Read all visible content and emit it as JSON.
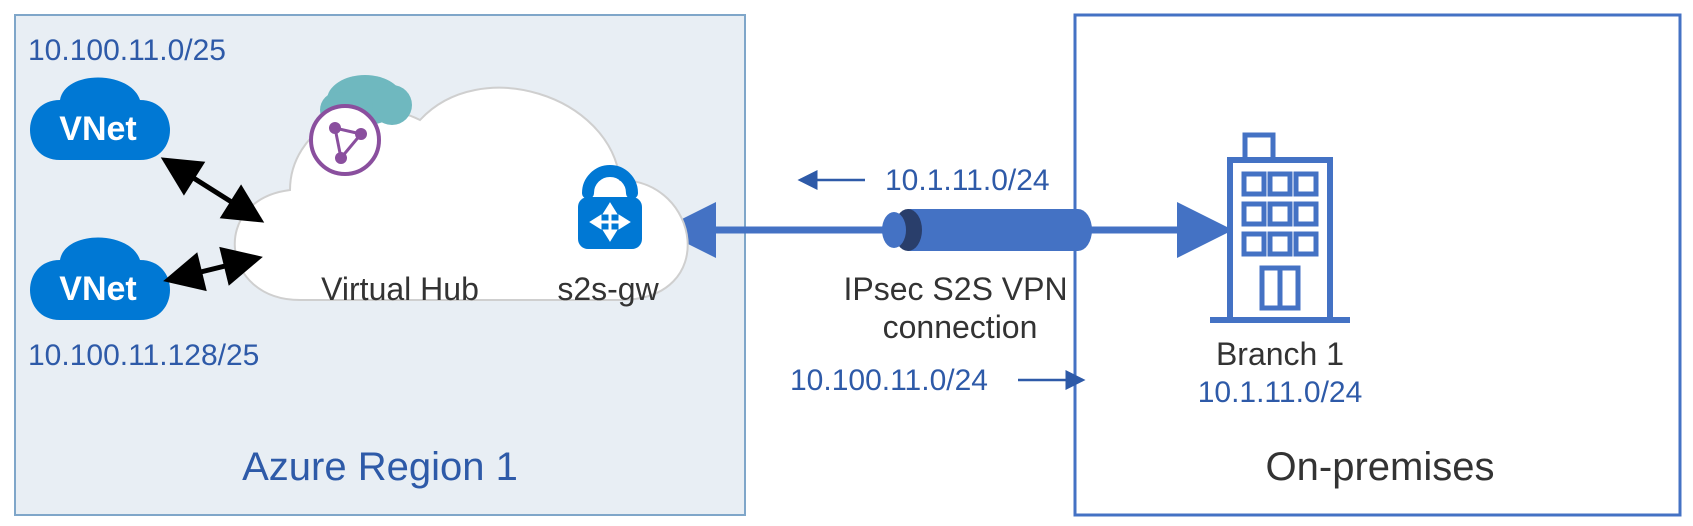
{
  "azure": {
    "region_label": "Azure Region 1",
    "hub_label": "Virtual Hub",
    "gateway_label": "s2s-gw",
    "vnet_top": {
      "label": "VNet",
      "cidr": "10.100.11.0/25"
    },
    "vnet_bottom": {
      "label": "VNet",
      "cidr": "10.100.11.128/25"
    }
  },
  "connection": {
    "type_line1": "IPsec S2S VPN",
    "type_line2": "connection",
    "inbound_cidr": "10.1.11.0/24",
    "outbound_cidr": "10.100.11.0/24"
  },
  "onprem": {
    "region_label": "On-premises",
    "branch_label": "Branch 1",
    "branch_cidr": "10.1.11.0/24"
  },
  "colors": {
    "azure_blue": "#0078D4",
    "light_blue_bg": "#E8EEF4",
    "label_blue": "#2E5AA8",
    "purple": "#8A4F9E",
    "teal": "#6FB8BF",
    "onprem_blue": "#4472C4"
  }
}
